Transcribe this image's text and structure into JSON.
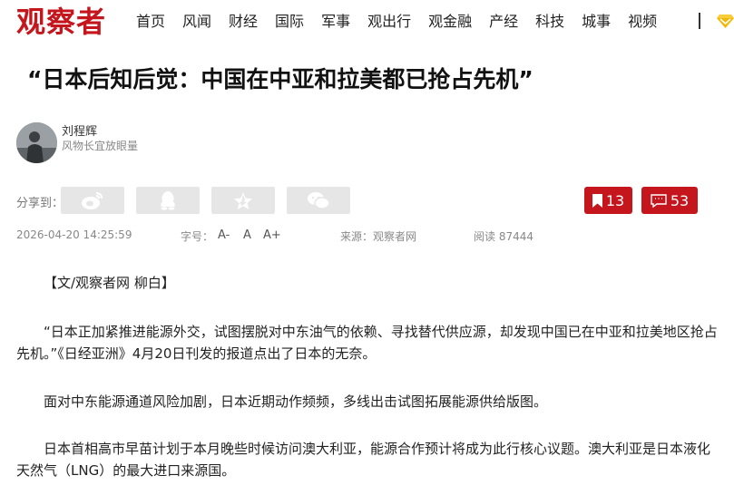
{
  "header": {
    "logo": "观察者",
    "nav": [
      "首页",
      "风闻",
      "财经",
      "国际",
      "军事",
      "观出行",
      "观金融",
      "产经",
      "科技",
      "城事",
      "视频"
    ],
    "separator": "|",
    "vip_icon": "vip-diamond-icon",
    "brand_color": "#c4161c"
  },
  "article": {
    "title": "“日本后知后觉：中国在中亚和拉美都已抢占先机”",
    "author": {
      "name": "刘程辉",
      "bio": "风物长宜放眼量",
      "avatar_icon": "author-avatar"
    },
    "share": {
      "label": "分享到：",
      "buttons": [
        "weibo-icon",
        "qq-icon",
        "qzone-star-icon",
        "wechat-icon"
      ]
    },
    "stats": {
      "bookmarks": "13",
      "comments": "53"
    },
    "meta": {
      "datetime": "2026-04-20 14:25:59",
      "font_label": "字号：",
      "font_options": [
        "A-",
        "A",
        "A+"
      ],
      "source": "来源：观察者网",
      "reads": "阅读 87444"
    },
    "paragraphs": [
      "【文/观察者网 柳白】",
      "“日本正加紧推进能源外交，试图摆脱对中东油气的依赖、寻找替代供应源，却发现中国已在中亚和拉美地区抢占先机。”《日经亚洲》4月20日刊发的报道点出了日本的无奈。",
      "面对中东能源通道风险加剧，日本近期动作频频，多线出击试图拓展能源供给版图。",
      "日本首相高市早苗计划于本月晚些时候访问澳大利亚，能源合作预计将成为此行核心议题。澳大利亚是日本液化天然气（LNG）的最大进口来源国。"
    ]
  }
}
